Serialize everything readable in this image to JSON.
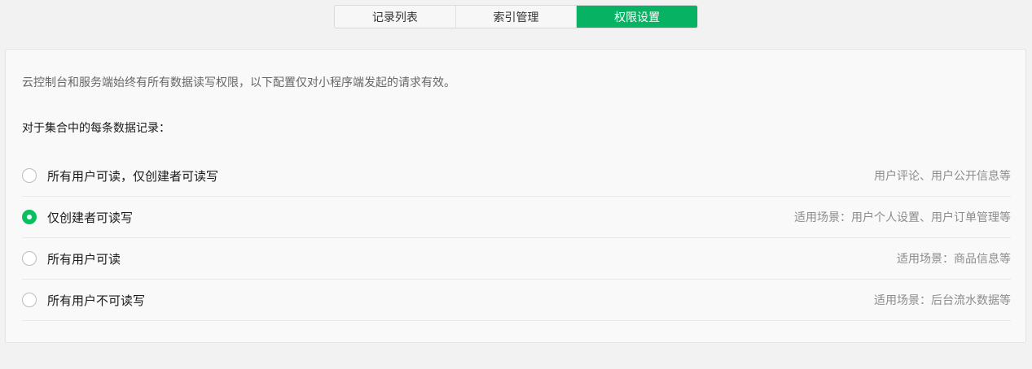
{
  "tabs": [
    {
      "label": "记录列表",
      "active": false
    },
    {
      "label": "索引管理",
      "active": false
    },
    {
      "label": "权限设置",
      "active": true
    }
  ],
  "colors": {
    "accent": "#07c160",
    "tab_active": "#07b262",
    "background": "#f2f2f2",
    "panel": "#f9f9f9"
  },
  "panel": {
    "notice": "云控制台和服务端始终有所有数据读写权限，以下配置仅对小程序端发起的请求有效。",
    "section_title": "对于集合中的每条数据记录：",
    "options": [
      {
        "label": "所有用户可读，仅创建者可读写",
        "hint": "用户评论、用户公开信息等",
        "checked": false
      },
      {
        "label": "仅创建者可读写",
        "hint": "适用场景：用户个人设置、用户订单管理等",
        "checked": true
      },
      {
        "label": "所有用户可读",
        "hint": "适用场景：商品信息等",
        "checked": false
      },
      {
        "label": "所有用户不可读写",
        "hint": "适用场景：后台流水数据等",
        "checked": false
      }
    ]
  }
}
